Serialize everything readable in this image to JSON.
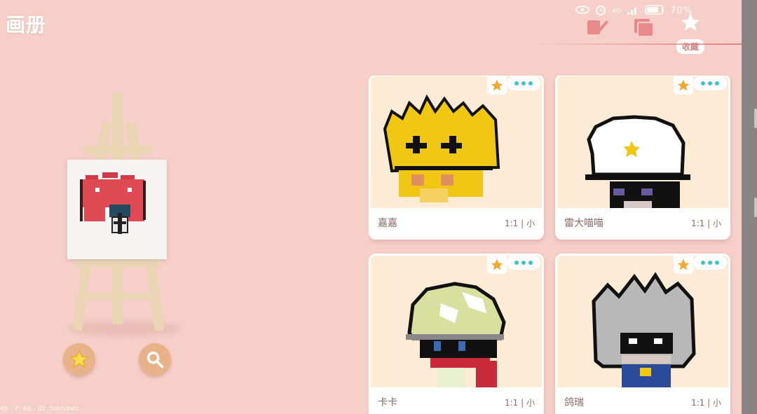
{
  "app": {
    "title": "画册"
  },
  "status": {
    "battery_text": "70%",
    "network": "4G"
  },
  "tabs": {
    "favorites_label": "收藏"
  },
  "debug": {
    "a": "49",
    "p": "P: 66",
    "id": "ID: 5chtvbwz"
  },
  "colors": {
    "accent_star": "#f3a630",
    "more_dots": "#3ec3c8",
    "button_bg": "#e8b38a"
  },
  "gallery": {
    "cards": [
      {
        "name": "嘉嘉",
        "meta": "1:1 | 小"
      },
      {
        "name": "雷大喵喵",
        "meta": "1:1 | 小"
      },
      {
        "name": "卡卡",
        "meta": "1:1 | 小"
      },
      {
        "name": "鸽瑞",
        "meta": "1:1 | 小"
      }
    ]
  },
  "bottom_buttons": {
    "favorites": "star-icon",
    "search": "search-icon"
  }
}
